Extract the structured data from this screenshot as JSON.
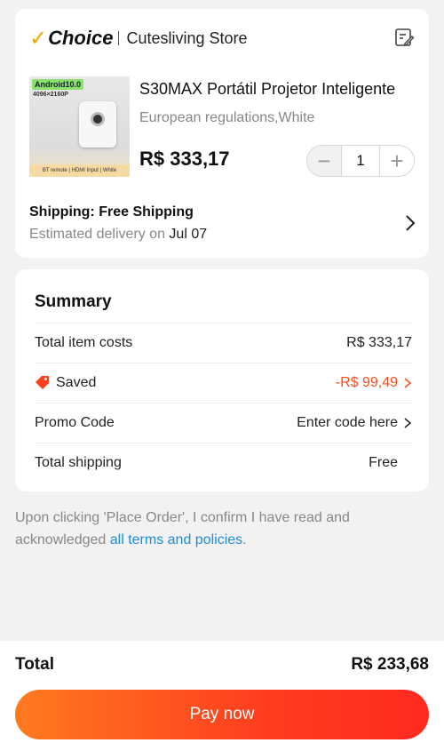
{
  "store": {
    "brand_check": "✓",
    "brand": "Choice",
    "name": "Cutesliving Store",
    "note_icon": "edit-note-icon"
  },
  "product": {
    "image_badge": "Android10.0",
    "image_resolution": "4096×2160P",
    "image_footer": "BT remote | HDMI Input | White",
    "title": "S30MAX Portátil Projetor Inteligente",
    "variant": "European regulations,White",
    "price": "R$ 333,17",
    "quantity": "1",
    "minus": "−",
    "plus": "+"
  },
  "shipping": {
    "title": "Shipping: Free Shipping",
    "eta_prefix": "Estimated delivery on",
    "eta_date": "Jul 07"
  },
  "summary": {
    "title": "Summary",
    "rows": [
      {
        "label": "Total item costs",
        "value": "R$ 333,17"
      },
      {
        "label": "Saved",
        "value": "-R$ 99,49"
      },
      {
        "label": "Promo Code",
        "value": "Enter code here"
      },
      {
        "label": "Total shipping",
        "value": "Free"
      }
    ]
  },
  "terms": {
    "text": "Upon clicking 'Place Order', I confirm I have read and acknowledged",
    "link": "all terms and policies",
    "end": "."
  },
  "checkout": {
    "total_label": "Total",
    "total_value": "R$ 233,68",
    "pay_label": "Pay now"
  },
  "colors": {
    "accent": "#ff3d1f",
    "saved": "#ff4a1a",
    "link": "#1f8bd9",
    "choice_check": "#f7a600"
  }
}
